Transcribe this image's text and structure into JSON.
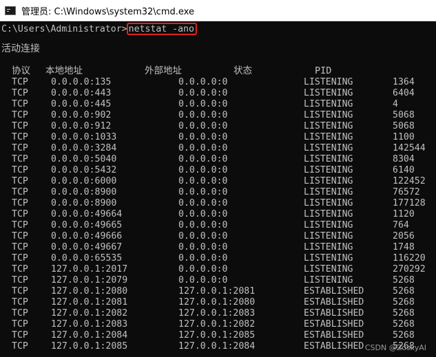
{
  "window": {
    "title": "管理员: C:\\Windows\\system32\\cmd.exe",
    "icon": "cmd-console-icon"
  },
  "console": {
    "prompt": "C:\\Users\\Administrator>",
    "command": "netstat -ano",
    "heading": "活动连接",
    "columns": {
      "proto": "协议",
      "local": "本地地址",
      "foreign": "外部地址",
      "state": "状态",
      "pid": "PID"
    },
    "rows": [
      {
        "proto": "TCP",
        "local": "0.0.0.0:135",
        "foreign": "0.0.0.0:0",
        "state": "LISTENING",
        "pid": "1364"
      },
      {
        "proto": "TCP",
        "local": "0.0.0.0:443",
        "foreign": "0.0.0.0:0",
        "state": "LISTENING",
        "pid": "6404"
      },
      {
        "proto": "TCP",
        "local": "0.0.0.0:445",
        "foreign": "0.0.0.0:0",
        "state": "LISTENING",
        "pid": "4"
      },
      {
        "proto": "TCP",
        "local": "0.0.0.0:902",
        "foreign": "0.0.0.0:0",
        "state": "LISTENING",
        "pid": "5068"
      },
      {
        "proto": "TCP",
        "local": "0.0.0.0:912",
        "foreign": "0.0.0.0:0",
        "state": "LISTENING",
        "pid": "5068"
      },
      {
        "proto": "TCP",
        "local": "0.0.0.0:1033",
        "foreign": "0.0.0.0:0",
        "state": "LISTENING",
        "pid": "1100"
      },
      {
        "proto": "TCP",
        "local": "0.0.0.0:3284",
        "foreign": "0.0.0.0:0",
        "state": "LISTENING",
        "pid": "142544"
      },
      {
        "proto": "TCP",
        "local": "0.0.0.0:5040",
        "foreign": "0.0.0.0:0",
        "state": "LISTENING",
        "pid": "8304"
      },
      {
        "proto": "TCP",
        "local": "0.0.0.0:5432",
        "foreign": "0.0.0.0:0",
        "state": "LISTENING",
        "pid": "6140"
      },
      {
        "proto": "TCP",
        "local": "0.0.0.0:6000",
        "foreign": "0.0.0.0:0",
        "state": "LISTENING",
        "pid": "122452"
      },
      {
        "proto": "TCP",
        "local": "0.0.0.0:8900",
        "foreign": "0.0.0.0:0",
        "state": "LISTENING",
        "pid": "76572"
      },
      {
        "proto": "TCP",
        "local": "0.0.0.0:8900",
        "foreign": "0.0.0.0:0",
        "state": "LISTENING",
        "pid": "177128"
      },
      {
        "proto": "TCP",
        "local": "0.0.0.0:49664",
        "foreign": "0.0.0.0:0",
        "state": "LISTENING",
        "pid": "1120"
      },
      {
        "proto": "TCP",
        "local": "0.0.0.0:49665",
        "foreign": "0.0.0.0:0",
        "state": "LISTENING",
        "pid": "764"
      },
      {
        "proto": "TCP",
        "local": "0.0.0.0:49666",
        "foreign": "0.0.0.0:0",
        "state": "LISTENING",
        "pid": "2056"
      },
      {
        "proto": "TCP",
        "local": "0.0.0.0:49667",
        "foreign": "0.0.0.0:0",
        "state": "LISTENING",
        "pid": "1748"
      },
      {
        "proto": "TCP",
        "local": "0.0.0.0:65535",
        "foreign": "0.0.0.0:0",
        "state": "LISTENING",
        "pid": "116220"
      },
      {
        "proto": "TCP",
        "local": "127.0.0.1:2017",
        "foreign": "0.0.0.0:0",
        "state": "LISTENING",
        "pid": "270292"
      },
      {
        "proto": "TCP",
        "local": "127.0.0.1:2079",
        "foreign": "0.0.0.0:0",
        "state": "LISTENING",
        "pid": "5268"
      },
      {
        "proto": "TCP",
        "local": "127.0.0.1:2080",
        "foreign": "127.0.0.1:2081",
        "state": "ESTABLISHED",
        "pid": "5268"
      },
      {
        "proto": "TCP",
        "local": "127.0.0.1:2081",
        "foreign": "127.0.0.1:2080",
        "state": "ESTABLISHED",
        "pid": "5268"
      },
      {
        "proto": "TCP",
        "local": "127.0.0.1:2082",
        "foreign": "127.0.0.1:2083",
        "state": "ESTABLISHED",
        "pid": "5268"
      },
      {
        "proto": "TCP",
        "local": "127.0.0.1:2083",
        "foreign": "127.0.0.1:2082",
        "state": "ESTABLISHED",
        "pid": "5268"
      },
      {
        "proto": "TCP",
        "local": "127.0.0.1:2084",
        "foreign": "127.0.0.1:2085",
        "state": "ESTABLISHED",
        "pid": "5268"
      },
      {
        "proto": "TCP",
        "local": "127.0.0.1:2085",
        "foreign": "127.0.0.1:2084",
        "state": "ESTABLISHED",
        "pid": "5268"
      }
    ],
    "highlight_color": "#e0221b",
    "text_color": "#c0c0c0",
    "background_color": "#0c0c0c"
  },
  "watermark": "CSDN @ZoskyAI"
}
